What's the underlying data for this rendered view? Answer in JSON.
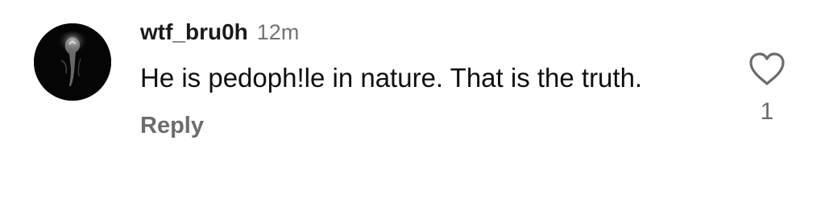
{
  "comment": {
    "username": "wtf_bru0h",
    "timestamp": "12m",
    "text": "He is pedoph!le in nature. That is the truth.",
    "reply_label": "Reply",
    "like_count": "1",
    "like_icon": "heart-outline-icon"
  },
  "colors": {
    "username": "#1a1a1a",
    "secondary_text": "#737373",
    "body_text": "#0f0f0f",
    "avatar_background": "#050505"
  }
}
